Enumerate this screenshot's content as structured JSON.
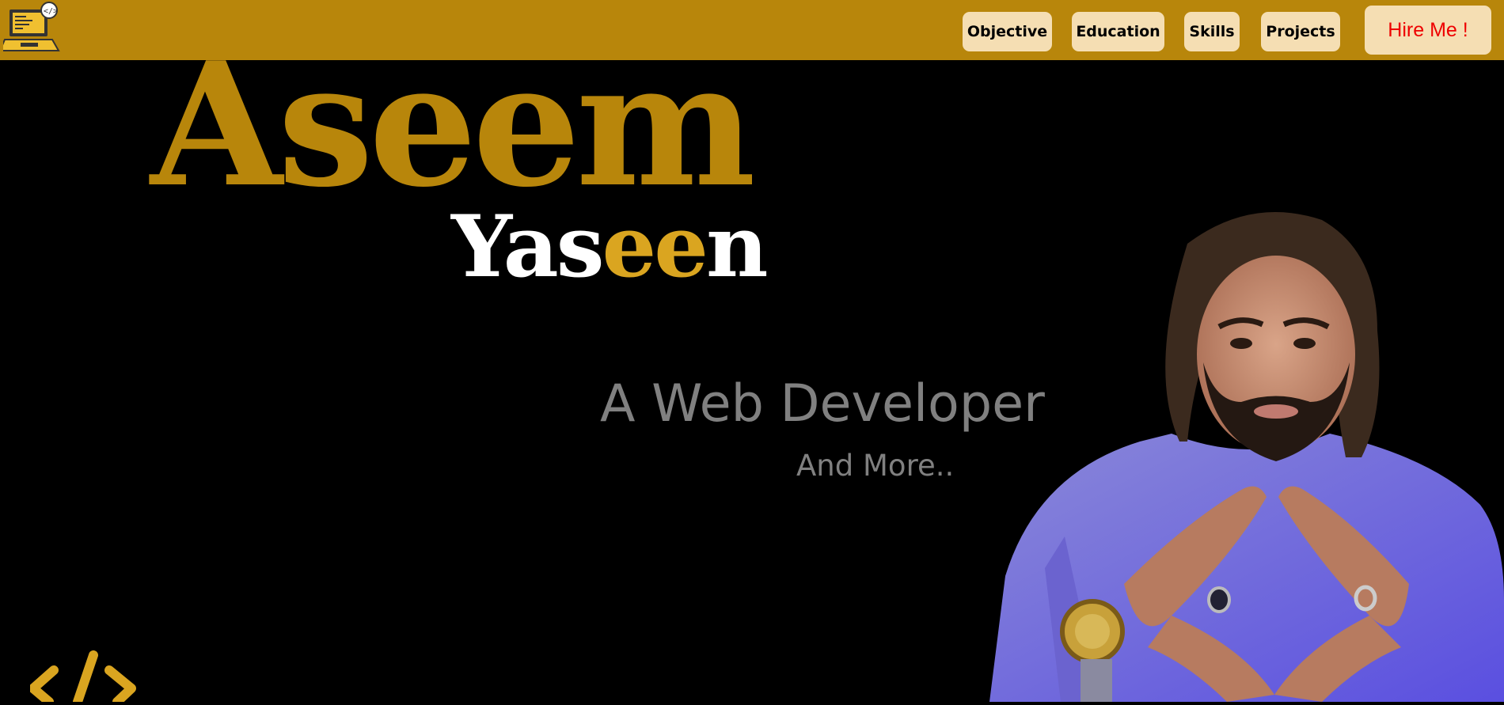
{
  "nav": {
    "logo_icon": "laptop-code-icon",
    "items": [
      {
        "label": "Objective"
      },
      {
        "label": "Education"
      },
      {
        "label": "Skills"
      },
      {
        "label": "Projects"
      }
    ],
    "hire_label": "Hire Me !"
  },
  "hero": {
    "first_name": "Aseem",
    "last_name_part1": "Yas",
    "last_name_accent": "ee",
    "last_name_part2": "n",
    "role": "A Web Developer",
    "more": "And More..",
    "portrait_icon": "portrait-photo",
    "code_icon": "code-brackets-icon"
  },
  "colors": {
    "topbar": "#b8860b",
    "button_bg": "#f5deb3",
    "hire_text": "#e00000",
    "first_name": "#b8860b",
    "accent": "#daa520",
    "subtitle": "#808080",
    "background": "#000000"
  }
}
